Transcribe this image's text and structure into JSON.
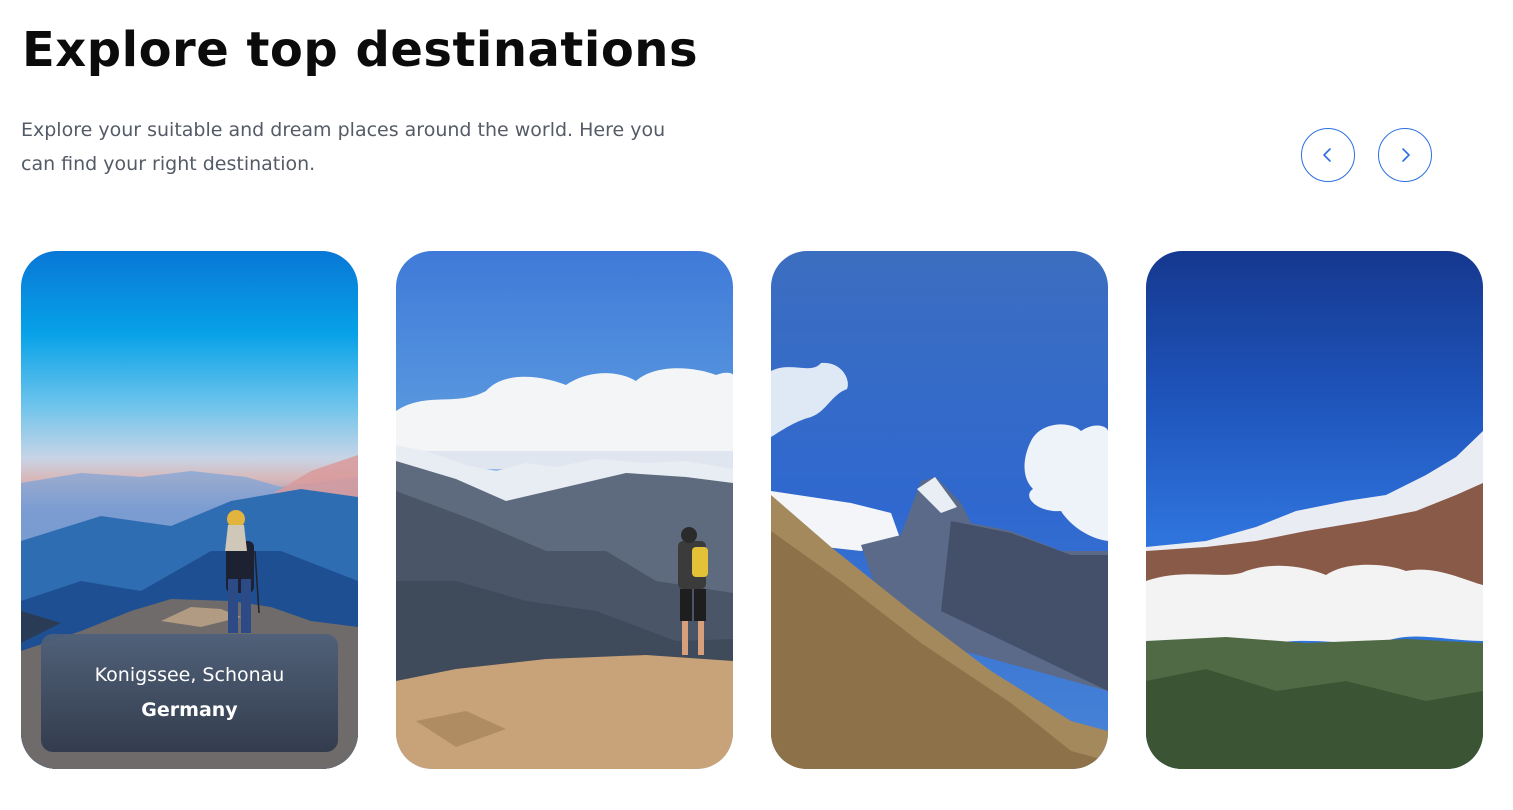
{
  "header": {
    "title": "Explore top destinations",
    "subtitle": "Explore your suitable and dream places around the world. Here you can find your right destination."
  },
  "carousel": {
    "prev_icon": "chevron-left-icon",
    "next_icon": "chevron-right-icon",
    "accent_color": "#2b70e0",
    "cards": [
      {
        "place": "Konigssee, Schonau",
        "country": "Germany",
        "scene": "hiker-on-ridge-at-dusk"
      },
      {
        "scene": "hiker-overlooking-snowy-range"
      },
      {
        "scene": "fishtail-peak-with-grassy-slope"
      },
      {
        "scene": "snow-ridge-above-clouds"
      }
    ]
  }
}
